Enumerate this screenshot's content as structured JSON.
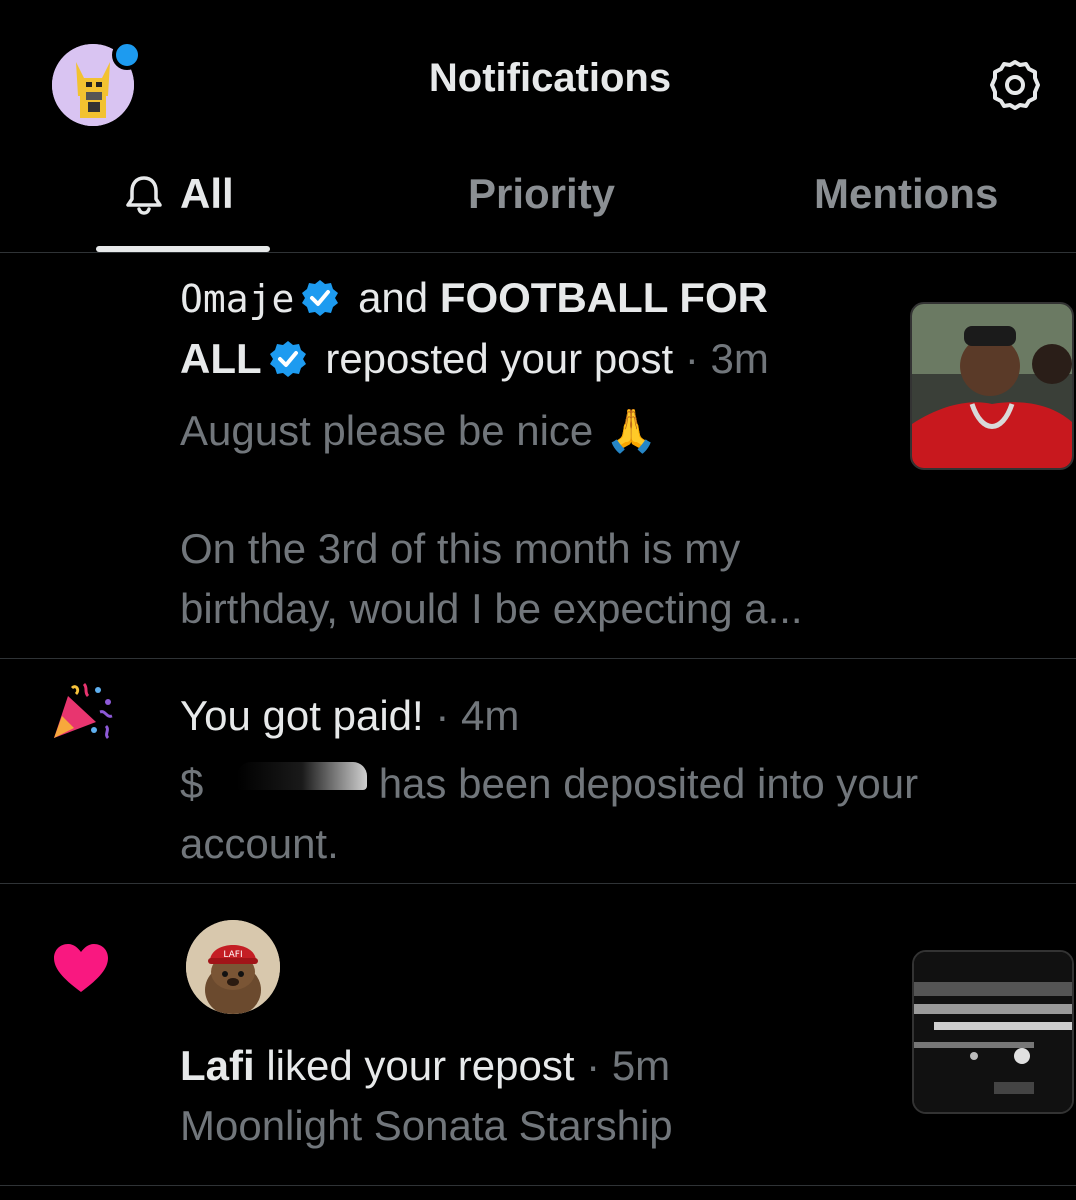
{
  "header": {
    "title": "Notifications"
  },
  "tabs": [
    {
      "label": "All"
    },
    {
      "label": "Priority"
    },
    {
      "label": "Mentions"
    }
  ],
  "notifications": [
    {
      "type": "repost",
      "user1": "Omaje",
      "joiner": "and",
      "user2_line1": "FOOTBALL FOR",
      "user2_line2": "ALL",
      "action": "reposted your post",
      "time": "· 3m",
      "post_line1": "August please be nice 🙏",
      "post_line2": "On the 3rd of this month is my",
      "post_line3": "birthday, would I be expecting a..."
    },
    {
      "type": "payment",
      "title": "You got paid!",
      "time": "· 4m",
      "body_prefix": "$",
      "body_line1": "has been deposited into your",
      "body_line2": "account."
    },
    {
      "type": "like",
      "user": "Lafi",
      "action": "liked your repost",
      "time": "· 5m",
      "post": "Moonlight Sonata Starship",
      "avatar_text": "LAFI"
    }
  ],
  "colors": {
    "background": "#000000",
    "verified": "#1d9bf0",
    "heart": "#f91880",
    "text": "#e7e9ea",
    "muted": "#71767b"
  }
}
